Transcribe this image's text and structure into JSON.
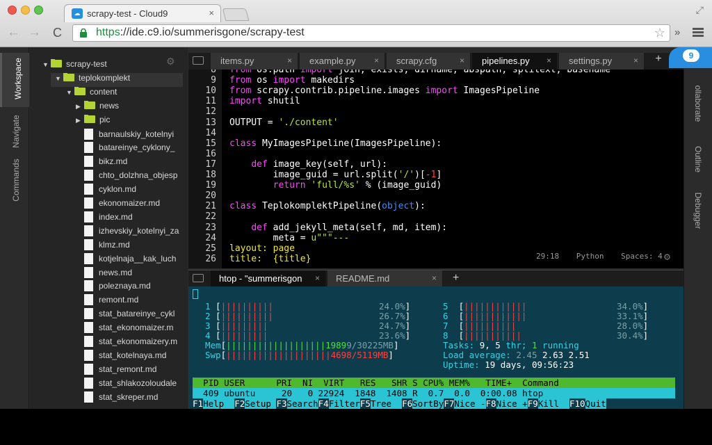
{
  "browser": {
    "tab_title": "scrapy-test - Cloud9",
    "tab_close": "×",
    "url_proto": "https",
    "url_rest": "://ide.c9.io/summerisgone/scrapy-test",
    "back": "←",
    "forward": "→",
    "reload": "C",
    "star": "☆",
    "ext": "»",
    "fullscreen": "⤢"
  },
  "rail": {
    "workspace": "Workspace",
    "navigate": "Navigate",
    "commands": "Commands"
  },
  "right_rail": {
    "collaborate": "ollaborate",
    "outline": "Outline",
    "debugger": "Debugger"
  },
  "tree": [
    {
      "label": "scrapy-test",
      "type": "folder",
      "open": true,
      "depth": 0
    },
    {
      "label": "teplokomplekt",
      "type": "folder",
      "open": true,
      "depth": 1,
      "selected": true
    },
    {
      "label": "content",
      "type": "folder",
      "open": true,
      "depth": 2
    },
    {
      "label": "news",
      "type": "folder",
      "open": false,
      "depth": 3
    },
    {
      "label": "pic",
      "type": "folder",
      "open": false,
      "depth": 3
    },
    {
      "label": "barnaulskiy_kotelnyi",
      "type": "file",
      "depth": 3
    },
    {
      "label": "batareinye_cyklony_",
      "type": "file",
      "depth": 3
    },
    {
      "label": "bikz.md",
      "type": "file",
      "depth": 3
    },
    {
      "label": "chto_dolzhna_objesp",
      "type": "file",
      "depth": 3
    },
    {
      "label": "cyklon.md",
      "type": "file",
      "depth": 3
    },
    {
      "label": "ekonomaizer.md",
      "type": "file",
      "depth": 3
    },
    {
      "label": "index.md",
      "type": "file",
      "depth": 3
    },
    {
      "label": "izhevskiy_kotelnyi_za",
      "type": "file",
      "depth": 3
    },
    {
      "label": "klmz.md",
      "type": "file",
      "depth": 3
    },
    {
      "label": "kotjelnaja__kak_luch",
      "type": "file",
      "depth": 3
    },
    {
      "label": "news.md",
      "type": "file",
      "depth": 3
    },
    {
      "label": "poleznaya.md",
      "type": "file",
      "depth": 3
    },
    {
      "label": "remont.md",
      "type": "file",
      "depth": 3
    },
    {
      "label": "stat_batareinye_cykl",
      "type": "file",
      "depth": 3
    },
    {
      "label": "stat_ekonomaizer.m",
      "type": "file",
      "depth": 3
    },
    {
      "label": "stat_ekonomaizery.m",
      "type": "file",
      "depth": 3
    },
    {
      "label": "stat_kotelnaya.md",
      "type": "file",
      "depth": 3
    },
    {
      "label": "stat_remont.md",
      "type": "file",
      "depth": 3
    },
    {
      "label": "stat_shlakozoloudale",
      "type": "file",
      "depth": 3
    },
    {
      "label": "stat_skreper.md",
      "type": "file",
      "depth": 3
    }
  ],
  "editor_tabs": [
    {
      "label": "items.py",
      "active": false
    },
    {
      "label": "example.py",
      "active": false
    },
    {
      "label": "scrapy.cfg",
      "active": false
    },
    {
      "label": "pipelines.py",
      "active": true
    },
    {
      "label": "settings.py",
      "active": false
    }
  ],
  "tab_close": "×",
  "add_tab": "+",
  "code_lines": [
    {
      "n": "8",
      "parts": [
        [
          "kw",
          "from"
        ],
        [
          "fn",
          " os.path "
        ],
        [
          "kw",
          "import"
        ],
        [
          "fn",
          " join, exists, dirname, abspath, splitext, basename"
        ]
      ]
    },
    {
      "n": "9",
      "parts": [
        [
          "kw",
          "from"
        ],
        [
          "fn",
          " os "
        ],
        [
          "kw",
          "import"
        ],
        [
          "fn",
          " makedirs"
        ]
      ]
    },
    {
      "n": "10",
      "parts": [
        [
          "kw",
          "from"
        ],
        [
          "fn",
          " scrapy.contrib.pipeline.images "
        ],
        [
          "kw",
          "import"
        ],
        [
          "fn",
          " ImagesPipeline"
        ]
      ]
    },
    {
      "n": "11",
      "parts": [
        [
          "kw",
          "import"
        ],
        [
          "fn",
          " shutil"
        ]
      ]
    },
    {
      "n": "12",
      "parts": []
    },
    {
      "n": "13",
      "parts": [
        [
          "fn",
          "OUTPUT = "
        ],
        [
          "st",
          "'./content'"
        ]
      ]
    },
    {
      "n": "14",
      "parts": []
    },
    {
      "n": "15",
      "parts": [
        [
          "kw",
          "class"
        ],
        [
          "fn",
          " MyImagesPipeline(ImagesPipeline):"
        ]
      ]
    },
    {
      "n": "16",
      "parts": []
    },
    {
      "n": "17",
      "parts": [
        [
          "fn",
          "    "
        ],
        [
          "kw",
          "def"
        ],
        [
          "fn",
          " image_key(self, url):"
        ]
      ]
    },
    {
      "n": "18",
      "parts": [
        [
          "fn",
          "        image_guid = url.split("
        ],
        [
          "st",
          "'/'"
        ],
        [
          "fn",
          ")["
        ],
        [
          "nm",
          "-1"
        ],
        [
          "fn",
          "]"
        ]
      ]
    },
    {
      "n": "19",
      "parts": [
        [
          "fn",
          "        "
        ],
        [
          "kw",
          "return"
        ],
        [
          "fn",
          " "
        ],
        [
          "st",
          "'full/%s'"
        ],
        [
          "fn",
          " % (image_guid)"
        ]
      ]
    },
    {
      "n": "20",
      "parts": []
    },
    {
      "n": "21",
      "parts": [
        [
          "kw",
          "class"
        ],
        [
          "fn",
          " TeplokomplektPipeline("
        ],
        [
          "cl-blue",
          "object"
        ],
        [
          "fn",
          "):"
        ]
      ]
    },
    {
      "n": "22",
      "parts": []
    },
    {
      "n": "23",
      "parts": [
        [
          "fn",
          "    "
        ],
        [
          "kw",
          "def"
        ],
        [
          "fn",
          " add_jekyll_meta(self, md, item):"
        ]
      ]
    },
    {
      "n": "24",
      "parts": [
        [
          "fn",
          "        meta = "
        ],
        [
          "st",
          "u\"\"\"---"
        ]
      ]
    },
    {
      "n": "25",
      "parts": [
        [
          "yl",
          "layout: page"
        ]
      ]
    },
    {
      "n": "26",
      "parts": [
        [
          "yl",
          "title:  {title}"
        ]
      ]
    }
  ],
  "status": {
    "position": "29:18",
    "language": "Python",
    "spaces": "Spaces: 4"
  },
  "term_tabs": [
    {
      "label": "htop - \"summerisgon",
      "active": true
    },
    {
      "label": "README.md",
      "active": false
    }
  ],
  "htop": {
    "cpus_left": [
      {
        "id": "1",
        "bars": "||||||||||",
        "pct": "24.0%"
      },
      {
        "id": "2",
        "bars": "||||||||||",
        "pct": "26.7%"
      },
      {
        "id": "3",
        "bars": "|||||||||",
        "pct": "24.7%"
      },
      {
        "id": "4",
        "bars": "|||||||||",
        "pct": "23.6%"
      }
    ],
    "cpus_right": [
      {
        "id": "5",
        "bars": "||||||||||||",
        "pct": "34.0%"
      },
      {
        "id": "6",
        "bars": "||||||||||||",
        "pct": "33.1%"
      },
      {
        "id": "7",
        "bars": "||||||||||",
        "pct": "28.0%"
      },
      {
        "id": "8",
        "bars": "|||||||||||",
        "pct": "30.4%"
      }
    ],
    "mem": {
      "label": "Mem",
      "bars": "|||||||||||||||||||1989",
      "value": "9/30225MB"
    },
    "swp": {
      "label": "Swp",
      "bars": "||||||||||||||||||||",
      "value": "4698/5119MB"
    },
    "tasks": {
      "label": "Tasks:",
      "n": "9,",
      "threads": "5",
      "thr": "thr;",
      "running": "1",
      "running_label": "running"
    },
    "load": {
      "label": "Load average:",
      "v1": "2.45",
      "v2": "2.63",
      "v3": "2.51"
    },
    "uptime": {
      "label": "Uptime:",
      "value": "19 days, 09:56:23"
    },
    "header": "  PID USER      PRI  NI  VIRT   RES   SHR S CPU% MEM%   TIME+  Command",
    "row": "  409 ubuntu     20   0 22924  1848  1408 R  0.7  0.0  0:00.08 htop",
    "fkeys": [
      {
        "k": "F1",
        "l": "Help  "
      },
      {
        "k": "F2",
        "l": "Setup "
      },
      {
        "k": "F3",
        "l": "Search"
      },
      {
        "k": "F4",
        "l": "Filter"
      },
      {
        "k": "F5",
        "l": "Tree  "
      },
      {
        "k": "F6",
        "l": "SortBy"
      },
      {
        "k": "F7",
        "l": "Nice -"
      },
      {
        "k": "F8",
        "l": "Nice +"
      },
      {
        "k": "F9",
        "l": "Kill  "
      },
      {
        "k": "F10",
        "l": "Quit"
      }
    ]
  }
}
